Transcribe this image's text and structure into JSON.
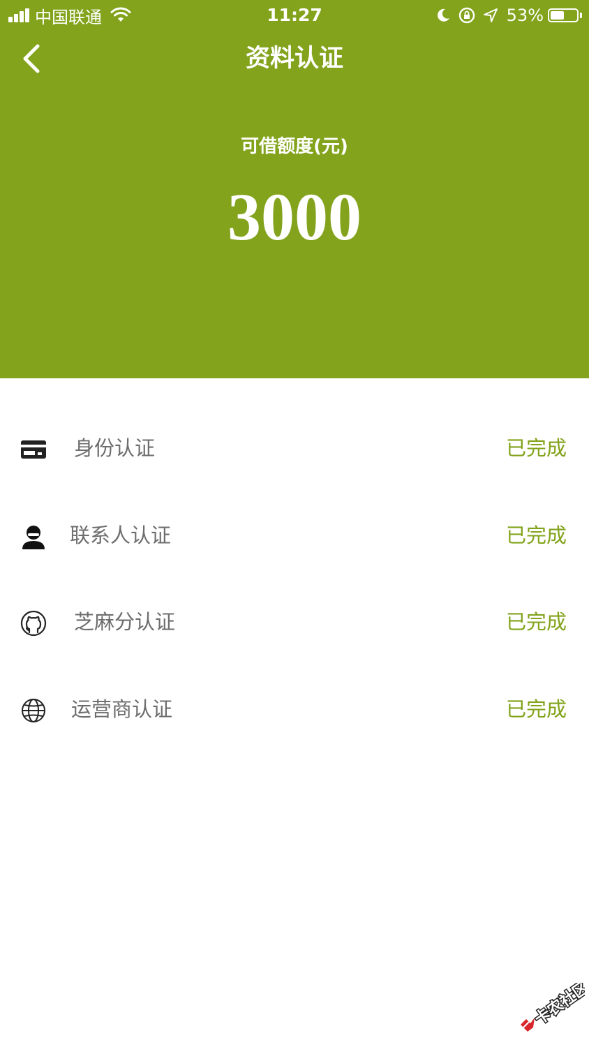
{
  "status_bar": {
    "carrier": "中国联通",
    "time": "11:27",
    "battery_percent": "53%",
    "battery_level": 0.53
  },
  "nav": {
    "title": "资料认证"
  },
  "credit": {
    "label": "可借额度(元)",
    "amount": "3000"
  },
  "verifications": [
    {
      "label": "身份认证",
      "status": "已完成",
      "icon": "id-card-icon"
    },
    {
      "label": "联系人认证",
      "status": "已完成",
      "icon": "contact-person-icon"
    },
    {
      "label": "芝麻分认证",
      "status": "已完成",
      "icon": "github-octocat-icon"
    },
    {
      "label": "运营商认证",
      "status": "已完成",
      "icon": "globe-icon"
    }
  ],
  "watermark": {
    "text": "卡农社区"
  },
  "colors": {
    "brand_green": "#82a31b",
    "label_gray": "#6d6d6d",
    "white": "#ffffff"
  }
}
